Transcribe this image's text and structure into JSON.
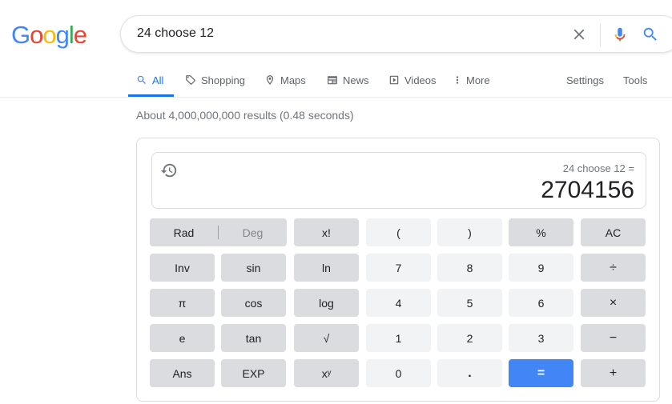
{
  "logo": {
    "letters": [
      "G",
      "o",
      "o",
      "g",
      "l",
      "e"
    ],
    "colors": [
      "#4285f4",
      "#ea4335",
      "#fbbc05",
      "#4285f4",
      "#34a853",
      "#ea4335"
    ]
  },
  "search": {
    "query": "24 choose 12",
    "clear_icon": "close-icon",
    "mic_icon": "microphone-icon",
    "search_icon": "search-icon"
  },
  "tabs": [
    {
      "label": "All",
      "icon": "search-icon",
      "active": true
    },
    {
      "label": "Shopping",
      "icon": "tag-icon"
    },
    {
      "label": "Maps",
      "icon": "map-pin-icon"
    },
    {
      "label": "News",
      "icon": "newspaper-icon"
    },
    {
      "label": "Videos",
      "icon": "play-icon"
    },
    {
      "label": "More",
      "icon": "more-vertical-icon"
    }
  ],
  "tools": {
    "settings": "Settings",
    "tools": "Tools"
  },
  "stats": "About 4,000,000,000 results (0.48 seconds)",
  "calculator": {
    "expression": "24 choose 12 =",
    "result": "2704156",
    "rad": "Rad",
    "deg": "Deg",
    "rows": [
      [
        null,
        null,
        "x!",
        "(",
        ")",
        "%",
        "AC"
      ],
      [
        "Inv",
        "sin",
        "ln",
        "7",
        "8",
        "9",
        "÷"
      ],
      [
        "π",
        "cos",
        "log",
        "4",
        "5",
        "6",
        "×"
      ],
      [
        "e",
        "tan",
        "√",
        "1",
        "2",
        "3",
        "−"
      ],
      [
        "Ans",
        "EXP",
        "xʸ",
        "0",
        ".",
        "=",
        "+"
      ]
    ]
  },
  "colors": {
    "accent": "#1a73e8",
    "equals": "#4285f4",
    "func_bg": "#dadce0",
    "num_bg": "#f1f3f4"
  }
}
